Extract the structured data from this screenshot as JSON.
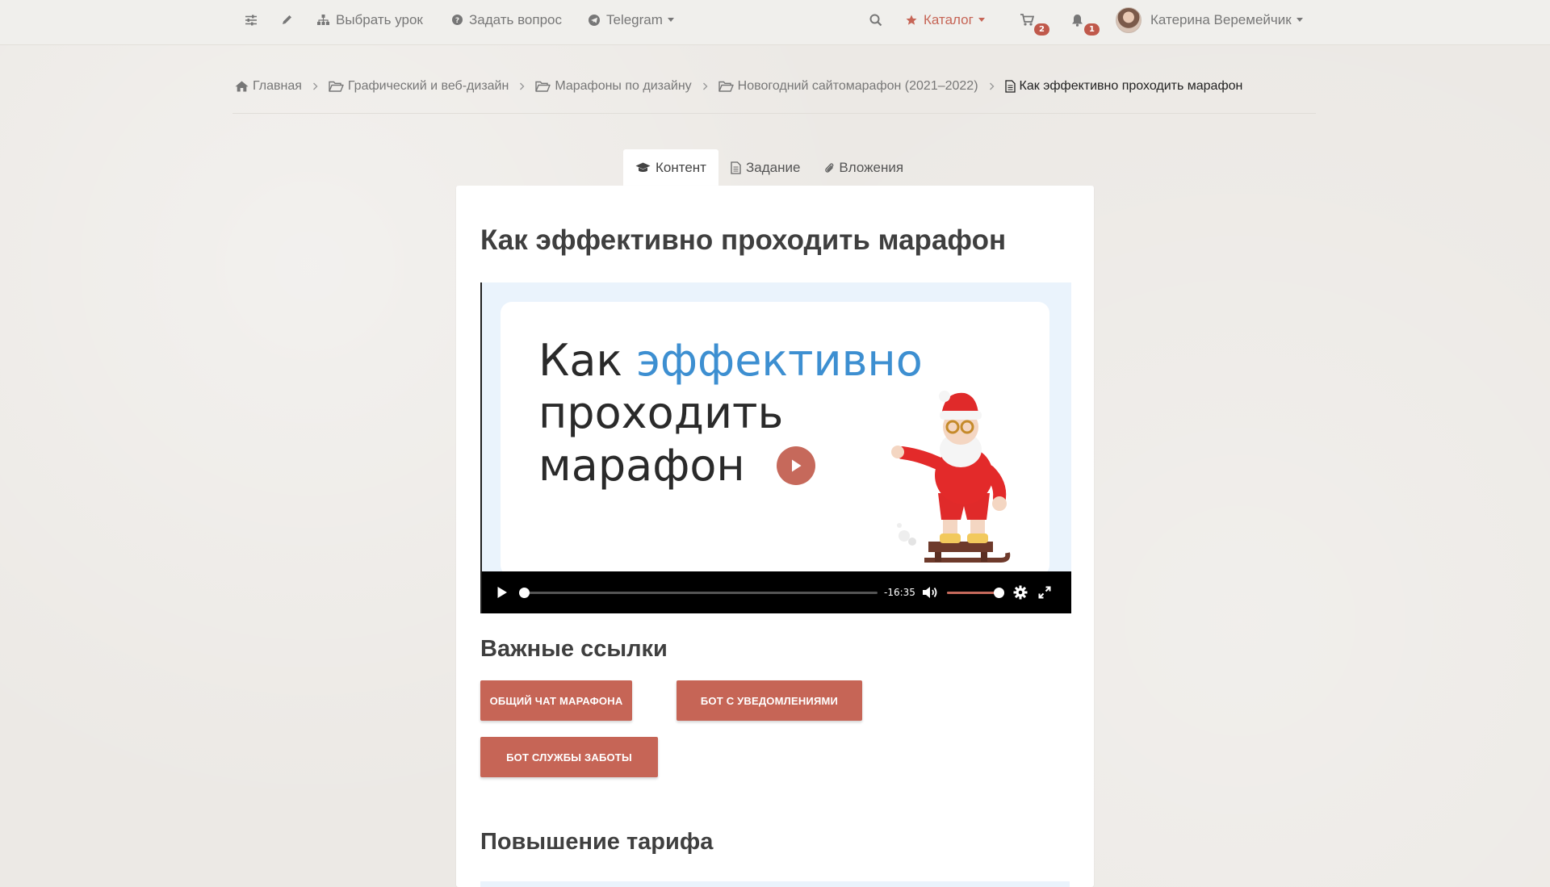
{
  "nav": {
    "choose_lesson": "Выбрать урок",
    "ask_question": "Задать вопрос",
    "telegram": "Telegram",
    "catalog": "Каталог",
    "cart_count": "2",
    "notif_count": "1",
    "user_name": "Катерина Веремейчик"
  },
  "breadcrumb": {
    "home": "Главная",
    "level1": "Графический и веб-дизайн",
    "level2": "Марафоны по дизайну",
    "level3": "Новогодний сайтомарафон (2021–2022)",
    "current": "Как эффективно проходить марафон"
  },
  "tabs": {
    "content": "Контент",
    "task": "Задание",
    "attachments": "Вложения"
  },
  "page": {
    "title": "Как эффективно проходить марафон"
  },
  "video": {
    "slide_word1": "Как ",
    "slide_word2": "эффективно",
    "slide_line2": "проходить",
    "slide_line3": "марафон",
    "time_remaining": "-16:35",
    "progress": 0.0,
    "volume": 1.0
  },
  "links": {
    "heading": "Важные ссылки",
    "chat_button": "ОБЩИЙ ЧАТ МАРАФОНА",
    "bot_notify_button": "БОТ С УВЕДОМЛЕНИЯМИ",
    "bot_care_button": "БОТ СЛУЖБЫ ЗАБОТЫ"
  },
  "tariff": {
    "heading": "Повышение тарифа"
  },
  "colors": {
    "accent": "#c66556",
    "highlight_blue": "#3d8fd1",
    "background": "#ece9e5"
  }
}
